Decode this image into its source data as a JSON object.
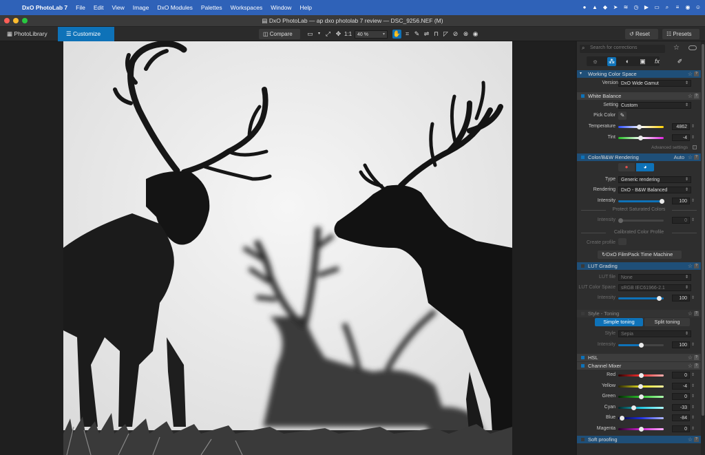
{
  "menubar": {
    "app_name": "DxO PhotoLab 7",
    "items": [
      "File",
      "Edit",
      "View",
      "Image",
      "DxO Modules",
      "Palettes",
      "Workspaces",
      "Window",
      "Help"
    ]
  },
  "window": {
    "title": "DxO PhotoLab — ap dxo photolab 7 review — DSC_9256.NEF (M)"
  },
  "toolbar": {
    "tab_library": "PhotoLibrary",
    "tab_customize": "Customize",
    "compare": "Compare",
    "one_to_one": "1:1",
    "zoom": "40 %",
    "reset": "Reset",
    "presets": "Presets"
  },
  "panel": {
    "search_placeholder": "Search for corrections",
    "working_color_space": {
      "title": "Working Color Space",
      "version_label": "Version",
      "version_value": "DxO Wide Gamut"
    },
    "white_balance": {
      "title": "White Balance",
      "setting_label": "Setting",
      "setting_value": "Custom",
      "pick_color_label": "Pick Color",
      "temperature_label": "Temperature",
      "temperature_value": "4862",
      "temperature_fraction": 0.46,
      "tint_label": "Tint",
      "tint_value": "-4",
      "tint_fraction": 0.48,
      "advanced": "Advanced settings"
    },
    "color_rendering": {
      "title": "Color/B&W Rendering",
      "auto": "Auto",
      "type_label": "Type",
      "type_value": "Generic rendering",
      "rendering_label": "Rendering",
      "rendering_value": "DxO - B&W Balanced",
      "intensity_label": "Intensity",
      "intensity_value": "100",
      "protect_header": "Protect Saturated Colors",
      "protect_intensity_label": "Intensity",
      "protect_intensity_value": "0",
      "calibrated_header": "Calibrated Color Profile",
      "create_profile_label": "Create profile",
      "filmpack_button": "DxO FilmPack Time Machine"
    },
    "lut_grading": {
      "title": "LUT Grading",
      "lut_file_label": "LUT file",
      "lut_file_value": "None",
      "lut_space_label": "LUT Color Space",
      "lut_space_value": "sRGB IEC61966-2.1",
      "intensity_label": "Intensity",
      "intensity_value": "100"
    },
    "style_toning": {
      "title": "Style - Toning",
      "simple": "Simple toning",
      "split": "Split toning",
      "style_label": "Style",
      "style_value": "Sepia",
      "intensity_label": "Intensity",
      "intensity_value": "100",
      "intensity_fraction": 0.5
    },
    "hsl": {
      "title": "HSL"
    },
    "channel_mixer": {
      "title": "Channel Mixer",
      "channels": [
        {
          "label": "Red",
          "value": "0",
          "fraction": 0.5,
          "gradient": "linear-gradient(90deg,#300000,#ff3030,#ffb0b0)"
        },
        {
          "label": "Yellow",
          "value": "-4",
          "fraction": 0.48,
          "gradient": "linear-gradient(90deg,#2a2800,#e8e020,#fff9a0)"
        },
        {
          "label": "Green",
          "value": "0",
          "fraction": 0.5,
          "gradient": "linear-gradient(90deg,#002a00,#30c830,#b0ffb0)"
        },
        {
          "label": "Cyan",
          "value": "-33",
          "fraction": 0.33,
          "gradient": "linear-gradient(90deg,#002a2a,#20c8e0,#b0ffff)"
        },
        {
          "label": "Blue",
          "value": "-84",
          "fraction": 0.08,
          "gradient": "linear-gradient(90deg,#00002a,#2030e0,#b0b8ff)"
        },
        {
          "label": "Magenta",
          "value": "0",
          "fraction": 0.5,
          "gradient": "linear-gradient(90deg,#2a002a,#d020d0,#ffb0ff)"
        }
      ]
    },
    "soft_proofing": {
      "title": "Soft proofing"
    }
  },
  "colors": {
    "accent": "#0e72b8",
    "menubar": "#2f62b8"
  }
}
